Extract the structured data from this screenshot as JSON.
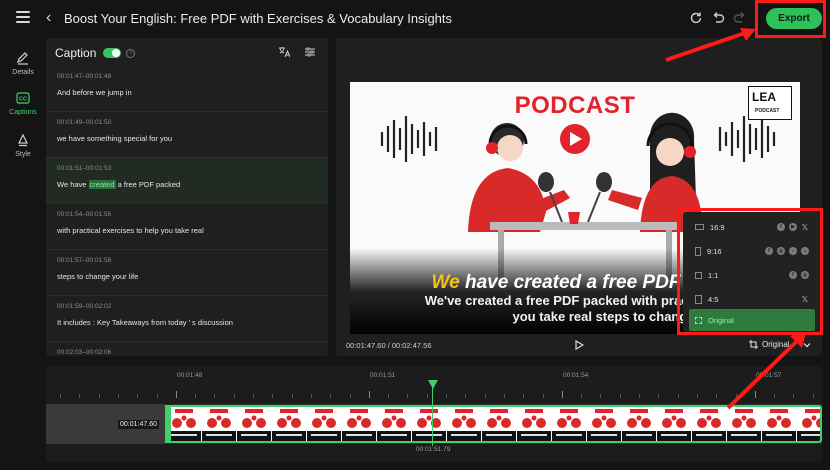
{
  "header": {
    "title": "Boost Your English: Free PDF with Exercises & Vocabulary Insights",
    "export_label": "Export"
  },
  "sidebar": {
    "items": [
      {
        "label": "Details",
        "icon": "edit-icon",
        "active": false
      },
      {
        "label": "Captions",
        "icon": "cc-icon",
        "active": true
      },
      {
        "label": "Style",
        "icon": "style-icon",
        "active": false
      }
    ]
  },
  "captions": {
    "title": "Caption",
    "enabled": true,
    "rows": [
      {
        "time": "00:01:47–00:01:48",
        "text": "And before we jump in"
      },
      {
        "time": "00:01:49–00:01:50",
        "text": "we have something special for you"
      },
      {
        "time": "00:01:51–00:01:53",
        "text_before": "We have ",
        "highlight": "created",
        "text_after": " a free PDF packed"
      },
      {
        "time": "00:01:54–00:01:56",
        "text": "with practical exercises to help you take real"
      },
      {
        "time": "00:01:57–00:01:58",
        "text": "steps to change your life"
      },
      {
        "time": "00:01:59–00:02:02",
        "text": "It includes : Key Takeaways from today ’ s discussion"
      },
      {
        "time": "00:02:03–00:02:06",
        "text": ""
      }
    ]
  },
  "preview": {
    "banner": "PODCAST",
    "logo_text": "LEA",
    "logo_sub": "PODCAST",
    "subtitle_highlight": "We",
    "subtitle_main": " have created a free PDF pac",
    "subtitle_line2": "We've created a free PDF packed with practical e",
    "subtitle_line3": "you take real steps to change your lif",
    "timecode": "00:01:47.60 / 00:02:47.56",
    "ratio_label": "Original"
  },
  "ratio_menu": {
    "options": [
      {
        "label": "16:9",
        "platforms": [
          "facebook",
          "youtube",
          "x"
        ]
      },
      {
        "label": "9:16",
        "platforms": [
          "facebook",
          "instagram",
          "tiktok",
          "snapchat"
        ]
      },
      {
        "label": "1:1",
        "platforms": [
          "facebook",
          "instagram"
        ]
      },
      {
        "label": "4:5",
        "platforms": [
          "x"
        ]
      },
      {
        "label": "Original",
        "platforms": [],
        "selected": true
      }
    ]
  },
  "timeline": {
    "ticks": [
      "00:01:48",
      "00:01:51",
      "00:01:54",
      "00:01:57"
    ],
    "clip_time": "00:01:47.60",
    "playhead_time": "00:01:51.79"
  },
  "colors": {
    "accent": "#2fbf5b",
    "annotation": "#ff1a1a",
    "podcast_red": "#e3232b",
    "subtitle_yellow": "#f6c21c"
  }
}
